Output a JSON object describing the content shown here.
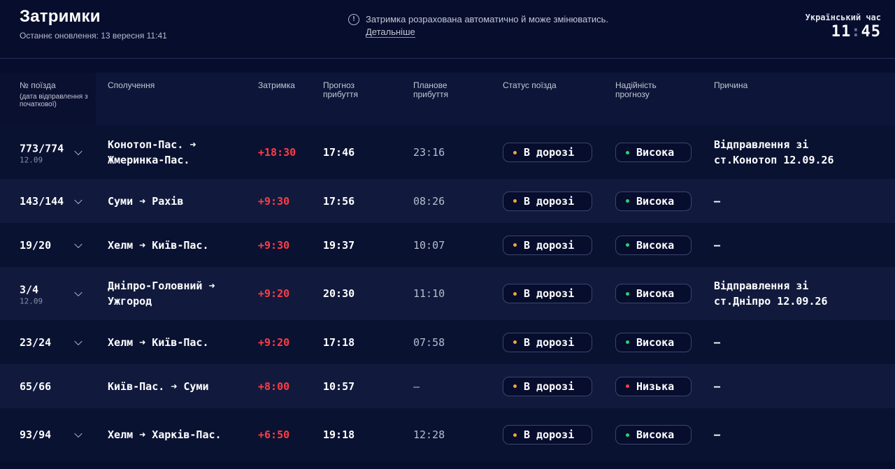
{
  "header": {
    "title": "Затримки",
    "updated": "Останнє оновлення: 13 вересня 11:41",
    "notice_icon": "info-icon",
    "notice_text": "Затримка розрахована автоматично й може змінюватись.",
    "notice_link": "Детальніше",
    "clock_label": "Український час",
    "clock_hours": "11",
    "clock_separator": ":",
    "clock_minutes": "45"
  },
  "columns": {
    "train": "№ поїзда",
    "train_sub": "(дата відправлення з початкової)",
    "route": "Сполучення",
    "delay": "Затримка",
    "forecast": "Прогноз прибуття",
    "planned": "Планове прибуття",
    "status": "Статус поїзда",
    "reliability": "Надійність прогнозу",
    "reason": "Причина"
  },
  "colors": {
    "background": "#070d2d",
    "delay": "#ff3c43",
    "status_dot": "#f0a53a",
    "high_dot": "#2fd06a",
    "low_dot": "#ff3c43"
  },
  "rows": [
    {
      "train": "773/774",
      "date": "12.09",
      "from": "Конотоп-Пас.",
      "to": "Жмеринка-Пас.",
      "delay": "+18:30",
      "forecast": "17:46",
      "planned": "23:16",
      "status": "В дорозі",
      "reliability": "Висока",
      "reliability_level": "high",
      "reason_line1": "Відправлення зі",
      "reason_line2": "ст.Конотоп 12.09.26",
      "expand_icon": "chevron-down-icon"
    },
    {
      "train": "143/144",
      "date": "",
      "from": "Суми",
      "to": "Рахів",
      "delay": "+9:30",
      "forecast": "17:56",
      "planned": "08:26",
      "status": "В дорозі",
      "reliability": "Висока",
      "reliability_level": "high",
      "reason_line1": "—",
      "reason_line2": "",
      "expand_icon": "chevron-down-icon"
    },
    {
      "train": "19/20",
      "date": "",
      "from": "Хелм",
      "to": "Київ-Пас.",
      "delay": "+9:30",
      "forecast": "19:37",
      "planned": "10:07",
      "status": "В дорозі",
      "reliability": "Висока",
      "reliability_level": "high",
      "reason_line1": "—",
      "reason_line2": "",
      "expand_icon": "chevron-down-icon"
    },
    {
      "train": "3/4",
      "date": "12.09",
      "from": "Дніпро-Головний",
      "to": "Ужгород",
      "delay": "+9:20",
      "forecast": "20:30",
      "planned": "11:10",
      "status": "В дорозі",
      "reliability": "Висока",
      "reliability_level": "high",
      "reason_line1": "Відправлення зі",
      "reason_line2": "ст.Дніпро 12.09.26",
      "expand_icon": "chevron-down-icon"
    },
    {
      "train": "23/24",
      "date": "",
      "from": "Хелм",
      "to": "Київ-Пас.",
      "delay": "+9:20",
      "forecast": "17:18",
      "planned": "07:58",
      "status": "В дорозі",
      "reliability": "Висока",
      "reliability_level": "high",
      "reason_line1": "—",
      "reason_line2": "",
      "expand_icon": "chevron-down-icon"
    },
    {
      "train": "65/66",
      "date": "",
      "from": "Київ-Пас.",
      "to": "Суми",
      "delay": "+8:00",
      "forecast": "10:57",
      "planned": "—",
      "status": "В дорозі",
      "reliability": "Низька",
      "reliability_level": "low",
      "reason_line1": "—",
      "reason_line2": "",
      "expand_icon": ""
    },
    {
      "train": "93/94",
      "date": "",
      "from": "Хелм",
      "to": "Харків-Пас.",
      "delay": "+6:50",
      "forecast": "19:18",
      "planned": "12:28",
      "status": "В дорозі",
      "reliability": "Висока",
      "reliability_level": "high",
      "reason_line1": "—",
      "reason_line2": "",
      "expand_icon": "chevron-down-icon"
    }
  ]
}
